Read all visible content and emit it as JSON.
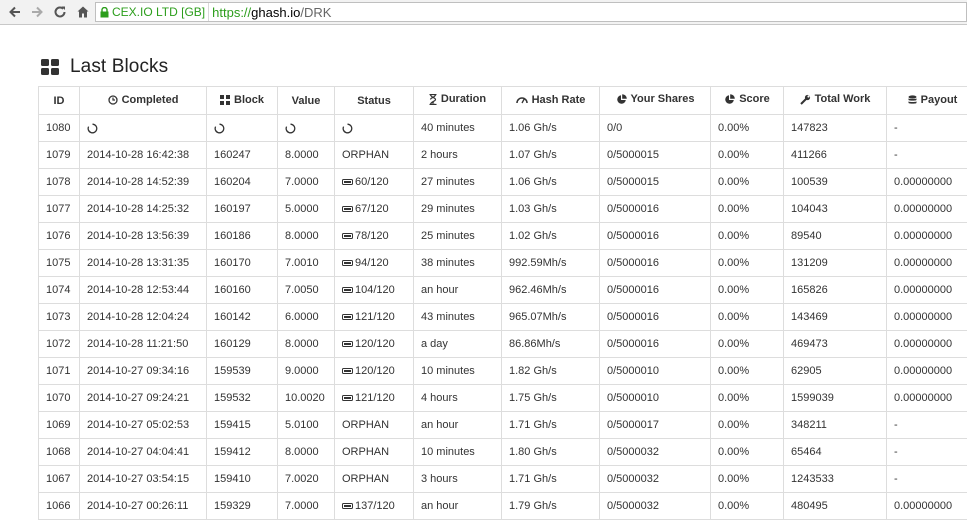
{
  "browser": {
    "secure_label": "CEX.IO LTD [GB]",
    "url_scheme": "https://",
    "url_host": "ghash.io",
    "url_path": "/DRK"
  },
  "page": {
    "title": "Last Blocks"
  },
  "table": {
    "columns": [
      {
        "label": "ID",
        "icon": ""
      },
      {
        "label": "Completed",
        "icon": "clock-icon"
      },
      {
        "label": "Block",
        "icon": "grid-icon"
      },
      {
        "label": "Value",
        "icon": ""
      },
      {
        "label": "Status",
        "icon": ""
      },
      {
        "label": "Duration",
        "icon": "hourglass-icon"
      },
      {
        "label": "Hash Rate",
        "icon": "dashboard-icon"
      },
      {
        "label": "Your Shares",
        "icon": "pie-chart-icon"
      },
      {
        "label": "Score",
        "icon": "pie-chart-icon"
      },
      {
        "label": "Total Work",
        "icon": "wrench-icon"
      },
      {
        "label": "Payout",
        "icon": "coins-icon"
      }
    ],
    "rows": [
      {
        "id": "1080",
        "completed": "",
        "block": "",
        "value": "",
        "status": "",
        "status_icon": "pending",
        "duration": "40 minutes",
        "hash_rate": "1.06 Gh/s",
        "shares": "0/0",
        "score": "0.00%",
        "total_work": "147823",
        "payout": "-"
      },
      {
        "id": "1079",
        "completed": "2014-10-28 16:42:38",
        "block": "160247",
        "value": "8.0000",
        "status": "ORPHAN",
        "status_icon": "",
        "duration": "2 hours",
        "hash_rate": "1.07 Gh/s",
        "shares": "0/5000015",
        "score": "0.00%",
        "total_work": "411266",
        "payout": "-"
      },
      {
        "id": "1078",
        "completed": "2014-10-28 14:52:39",
        "block": "160204",
        "value": "7.0000",
        "status": "60/120",
        "status_icon": "bar",
        "duration": "27 minutes",
        "hash_rate": "1.06 Gh/s",
        "shares": "0/5000015",
        "score": "0.00%",
        "total_work": "100539",
        "payout": "0.00000000"
      },
      {
        "id": "1077",
        "completed": "2014-10-28 14:25:32",
        "block": "160197",
        "value": "5.0000",
        "status": "67/120",
        "status_icon": "bar",
        "duration": "29 minutes",
        "hash_rate": "1.03 Gh/s",
        "shares": "0/5000016",
        "score": "0.00%",
        "total_work": "104043",
        "payout": "0.00000000"
      },
      {
        "id": "1076",
        "completed": "2014-10-28 13:56:39",
        "block": "160186",
        "value": "8.0000",
        "status": "78/120",
        "status_icon": "bar",
        "duration": "25 minutes",
        "hash_rate": "1.02 Gh/s",
        "shares": "0/5000016",
        "score": "0.00%",
        "total_work": "89540",
        "payout": "0.00000000"
      },
      {
        "id": "1075",
        "completed": "2014-10-28 13:31:35",
        "block": "160170",
        "value": "7.0010",
        "status": "94/120",
        "status_icon": "bar",
        "duration": "38 minutes",
        "hash_rate": "992.59Mh/s",
        "shares": "0/5000016",
        "score": "0.00%",
        "total_work": "131209",
        "payout": "0.00000000"
      },
      {
        "id": "1074",
        "completed": "2014-10-28 12:53:44",
        "block": "160160",
        "value": "7.0050",
        "status": "104/120",
        "status_icon": "bar",
        "duration": "an hour",
        "hash_rate": "962.46Mh/s",
        "shares": "0/5000016",
        "score": "0.00%",
        "total_work": "165826",
        "payout": "0.00000000"
      },
      {
        "id": "1073",
        "completed": "2014-10-28 12:04:24",
        "block": "160142",
        "value": "6.0000",
        "status": "121/120",
        "status_icon": "bar",
        "duration": "43 minutes",
        "hash_rate": "965.07Mh/s",
        "shares": "0/5000016",
        "score": "0.00%",
        "total_work": "143469",
        "payout": "0.00000000"
      },
      {
        "id": "1072",
        "completed": "2014-10-28 11:21:50",
        "block": "160129",
        "value": "8.0000",
        "status": "120/120",
        "status_icon": "bar",
        "duration": "a day",
        "hash_rate": "86.86Mh/s",
        "shares": "0/5000016",
        "score": "0.00%",
        "total_work": "469473",
        "payout": "0.00000000"
      },
      {
        "id": "1071",
        "completed": "2014-10-27 09:34:16",
        "block": "159539",
        "value": "9.0000",
        "status": "120/120",
        "status_icon": "bar",
        "duration": "10 minutes",
        "hash_rate": "1.82 Gh/s",
        "shares": "0/5000010",
        "score": "0.00%",
        "total_work": "62905",
        "payout": "0.00000000"
      },
      {
        "id": "1070",
        "completed": "2014-10-27 09:24:21",
        "block": "159532",
        "value": "10.0020",
        "status": "121/120",
        "status_icon": "bar",
        "duration": "4 hours",
        "hash_rate": "1.75 Gh/s",
        "shares": "0/5000010",
        "score": "0.00%",
        "total_work": "1599039",
        "payout": "0.00000000"
      },
      {
        "id": "1069",
        "completed": "2014-10-27 05:02:53",
        "block": "159415",
        "value": "5.0100",
        "status": "ORPHAN",
        "status_icon": "",
        "duration": "an hour",
        "hash_rate": "1.71 Gh/s",
        "shares": "0/5000017",
        "score": "0.00%",
        "total_work": "348211",
        "payout": "-"
      },
      {
        "id": "1068",
        "completed": "2014-10-27 04:04:41",
        "block": "159412",
        "value": "8.0000",
        "status": "ORPHAN",
        "status_icon": "",
        "duration": "10 minutes",
        "hash_rate": "1.80 Gh/s",
        "shares": "0/5000032",
        "score": "0.00%",
        "total_work": "65464",
        "payout": "-"
      },
      {
        "id": "1067",
        "completed": "2014-10-27 03:54:15",
        "block": "159410",
        "value": "7.0020",
        "status": "ORPHAN",
        "status_icon": "",
        "duration": "3 hours",
        "hash_rate": "1.71 Gh/s",
        "shares": "0/5000032",
        "score": "0.00%",
        "total_work": "1243533",
        "payout": "-"
      },
      {
        "id": "1066",
        "completed": "2014-10-27 00:26:11",
        "block": "159329",
        "value": "7.0000",
        "status": "137/120",
        "status_icon": "bar",
        "duration": "an hour",
        "hash_rate": "1.79 Gh/s",
        "shares": "0/5000032",
        "score": "0.00%",
        "total_work": "480495",
        "payout": "0.00000000"
      }
    ]
  },
  "colors": {
    "secure_green": "#2c9e1c",
    "border": "#dddddd",
    "text": "#333333"
  }
}
